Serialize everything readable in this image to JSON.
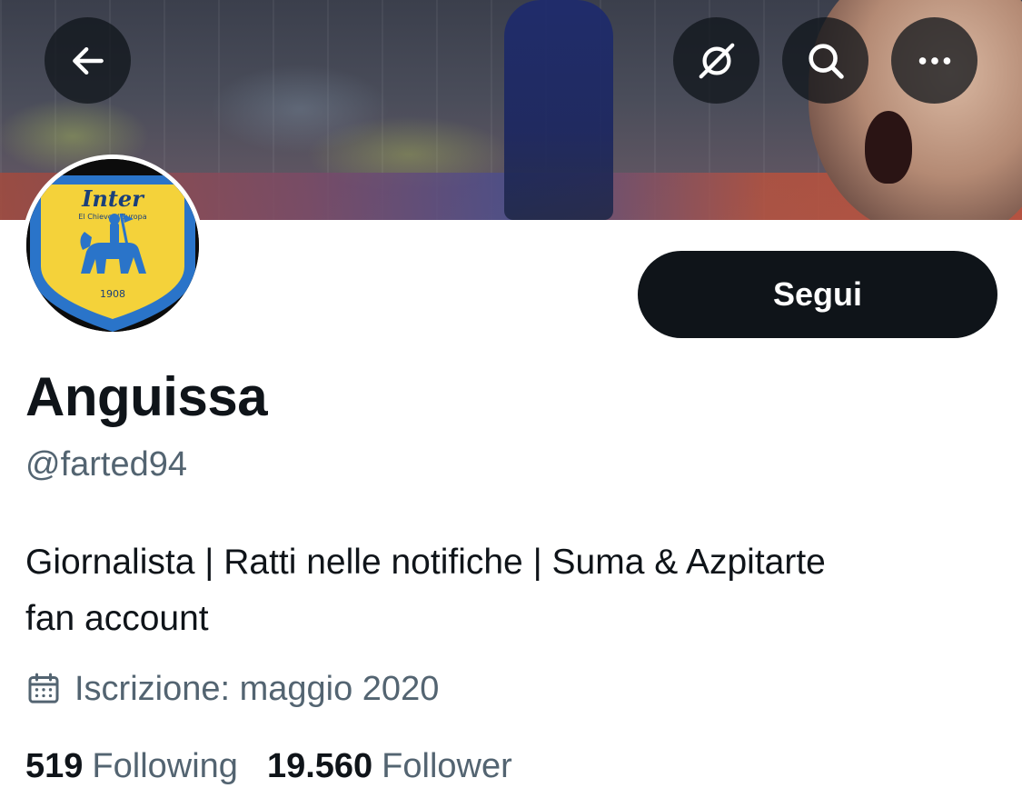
{
  "header": {
    "back_icon": "arrow-left-icon",
    "grok_icon": "grok-icon",
    "search_icon": "search-icon",
    "more_icon": "more-horizontal-icon"
  },
  "avatar": {
    "crest_text": "Inter",
    "crest_subtext": "El Chievo d'Europa",
    "crest_year": "1908",
    "crest_colors": {
      "gold": "#f4d23a",
      "blue": "#2a74c9",
      "navy": "#1a3f7a"
    }
  },
  "profile": {
    "follow_label": "Segui",
    "display_name": "Anguissa",
    "handle": "@farted94",
    "bio_line1": "Giornalista | Ratti nelle notifiche | Suma & Azpitarte",
    "bio_line2": "fan account",
    "joined_icon": "calendar-icon",
    "joined_text": "Iscrizione: maggio 2020"
  },
  "stats": {
    "following_count": "519",
    "following_label": "Following",
    "followers_count": "19.560",
    "followers_label": "Follower"
  },
  "colors": {
    "text_primary": "#0f1419",
    "text_secondary": "#536471",
    "button_bg": "#0f1419",
    "button_text": "#ffffff"
  }
}
